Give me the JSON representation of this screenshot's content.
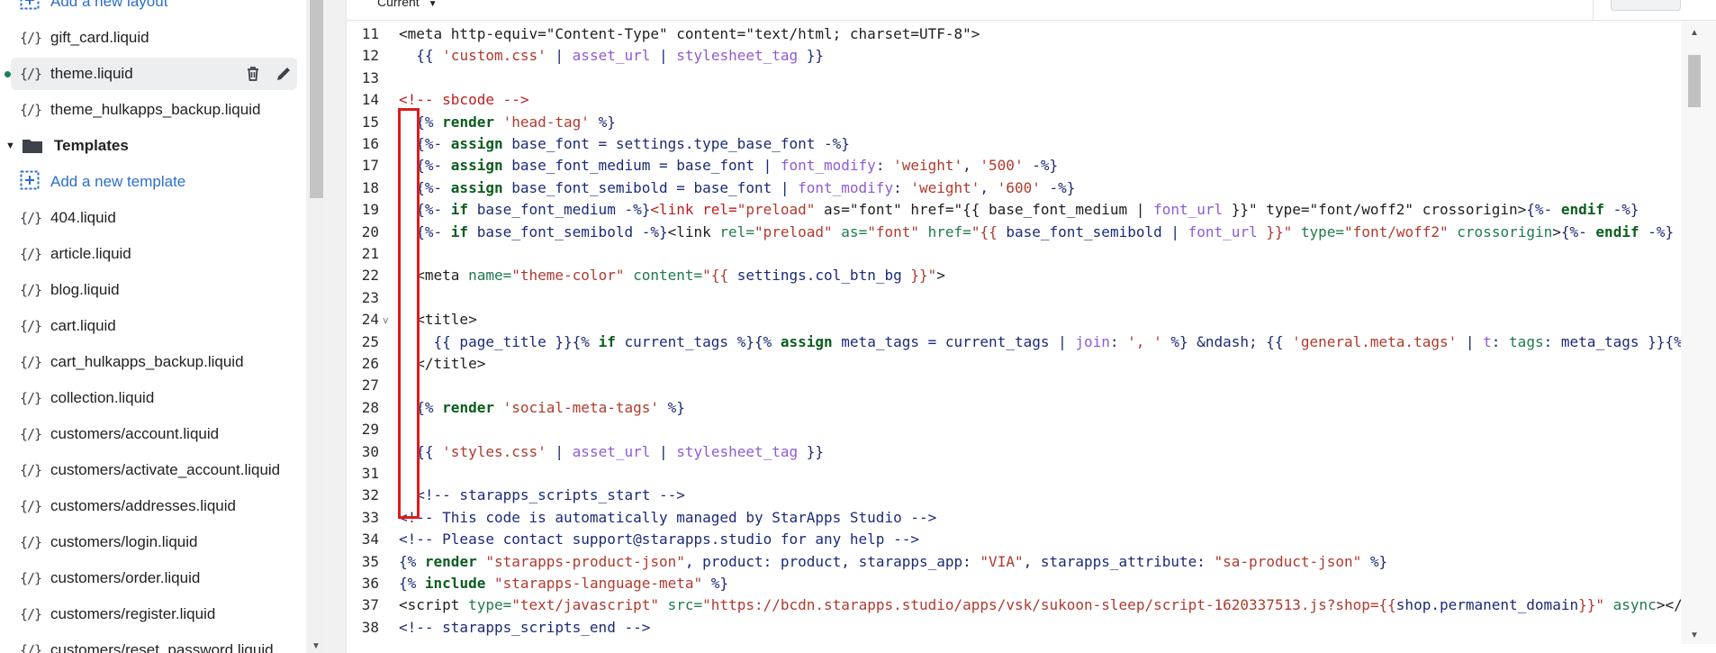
{
  "sidebar": {
    "items": [
      {
        "type": "link",
        "icon": "add-layout-icon",
        "label": "Add a new layout"
      },
      {
        "type": "file",
        "label": "gift_card.liquid"
      },
      {
        "type": "file",
        "label": "theme.liquid",
        "selected": true
      },
      {
        "type": "file",
        "label": "theme_hulkapps_backup.liquid"
      },
      {
        "type": "folder",
        "label": "Templates"
      },
      {
        "type": "link",
        "icon": "add-template-icon",
        "label": "Add a new template"
      },
      {
        "type": "file",
        "label": "404.liquid"
      },
      {
        "type": "file",
        "label": "article.liquid"
      },
      {
        "type": "file",
        "label": "blog.liquid"
      },
      {
        "type": "file",
        "label": "cart.liquid"
      },
      {
        "type": "file",
        "label": "cart_hulkapps_backup.liquid"
      },
      {
        "type": "file",
        "label": "collection.liquid"
      },
      {
        "type": "file",
        "label": "customers/account.liquid"
      },
      {
        "type": "file",
        "label": "customers/activate_account.liquid"
      },
      {
        "type": "file",
        "label": "customers/addresses.liquid"
      },
      {
        "type": "file",
        "label": "customers/login.liquid"
      },
      {
        "type": "file",
        "label": "customers/order.liquid"
      },
      {
        "type": "file",
        "label": "customers/register.liquid"
      },
      {
        "type": "file",
        "label": "customers/reset_password.liquid"
      }
    ],
    "file_icon_text": "{/}"
  },
  "editor": {
    "version_label": "Current",
    "lines": [
      {
        "n": "11",
        "t": [
          [
            "t",
            "<meta http-equiv=\"Content-Type\" content=\"text/html; charset=UTF-8\">"
          ]
        ]
      },
      {
        "n": "12",
        "t": [
          [
            "d",
            "  {{ "
          ],
          [
            "s",
            "'custom.css'"
          ],
          [
            "d",
            " | "
          ],
          [
            "f",
            "asset_url"
          ],
          [
            "d",
            " | "
          ],
          [
            "f",
            "stylesheet_tag"
          ],
          [
            "d",
            " }}"
          ]
        ]
      },
      {
        "n": "13",
        "t": []
      },
      {
        "n": "14",
        "t": [
          [
            "c",
            "<!-- sbcode -->"
          ]
        ]
      },
      {
        "n": "15",
        "t": [
          [
            "d",
            "  {% "
          ],
          [
            "k",
            "render"
          ],
          [
            "d",
            " "
          ],
          [
            "s",
            "'head-tag'"
          ],
          [
            "d",
            " %}"
          ]
        ]
      },
      {
        "n": "16",
        "t": [
          [
            "d",
            "  {%- "
          ],
          [
            "k",
            "assign"
          ],
          [
            "d",
            " base_font = settings.type_base_font -%}"
          ]
        ]
      },
      {
        "n": "17",
        "t": [
          [
            "d",
            "  {%- "
          ],
          [
            "k",
            "assign"
          ],
          [
            "d",
            " base_font_medium = base_font | "
          ],
          [
            "f",
            "font_modify"
          ],
          [
            "d",
            ": "
          ],
          [
            "s",
            "'weight'"
          ],
          [
            "d",
            ", "
          ],
          [
            "s",
            "'500'"
          ],
          [
            "d",
            " -%}"
          ]
        ]
      },
      {
        "n": "18",
        "t": [
          [
            "d",
            "  {%- "
          ],
          [
            "k",
            "assign"
          ],
          [
            "d",
            " base_font_semibold = base_font | "
          ],
          [
            "f",
            "font_modify"
          ],
          [
            "d",
            ": "
          ],
          [
            "s",
            "'weight'"
          ],
          [
            "d",
            ", "
          ],
          [
            "s",
            "'600'"
          ],
          [
            "d",
            " -%}"
          ]
        ]
      },
      {
        "n": "19",
        "t": [
          [
            "d",
            "  {%- "
          ],
          [
            "k",
            "if"
          ],
          [
            "d",
            " base_font_medium -%}"
          ],
          [
            "c",
            "<link rel="
          ],
          [
            "s",
            "\"preload\""
          ],
          [
            "t",
            " as=\"font\" href=\"{{ base_font_medium | "
          ],
          [
            "f",
            "font_url"
          ],
          [
            "t",
            " }}\" type=\"font/woff2\" crossorigin>"
          ],
          [
            "d",
            "{%- "
          ],
          [
            "k",
            "endif"
          ],
          [
            "d",
            " -%}"
          ]
        ]
      },
      {
        "n": "20",
        "t": [
          [
            "d",
            "  {%- "
          ],
          [
            "k",
            "if"
          ],
          [
            "d",
            " base_font_semibold -%}"
          ],
          [
            "t",
            "<link "
          ],
          [
            "a",
            "rel="
          ],
          [
            "s",
            "\"preload\""
          ],
          [
            "t",
            " "
          ],
          [
            "a",
            "as="
          ],
          [
            "s",
            "\"font\""
          ],
          [
            "t",
            " "
          ],
          [
            "a",
            "href="
          ],
          [
            "s",
            "\"{{ "
          ],
          [
            "d",
            "base_font_semibold | "
          ],
          [
            "f",
            "font_url"
          ],
          [
            "s",
            " }}\""
          ],
          [
            "t",
            " "
          ],
          [
            "a",
            "type="
          ],
          [
            "s",
            "\"font/woff2\""
          ],
          [
            "t",
            " "
          ],
          [
            "a",
            "crossorigin"
          ],
          [
            "t",
            ">"
          ],
          [
            "d",
            "{%- "
          ],
          [
            "k",
            "endif"
          ],
          [
            "d",
            " -%}"
          ]
        ]
      },
      {
        "n": "21",
        "t": []
      },
      {
        "n": "22",
        "t": [
          [
            "t",
            "  <meta "
          ],
          [
            "a",
            "name="
          ],
          [
            "s",
            "\"theme-color\""
          ],
          [
            "t",
            " "
          ],
          [
            "a",
            "content="
          ],
          [
            "s",
            "\"{{ "
          ],
          [
            "d",
            "settings.col_btn_bg"
          ],
          [
            "s",
            " }}\""
          ],
          [
            "t",
            ">"
          ]
        ]
      },
      {
        "n": "23",
        "t": []
      },
      {
        "n": "24",
        "fold": true,
        "t": [
          [
            "t",
            "  <title>"
          ]
        ]
      },
      {
        "n": "25",
        "t": [
          [
            "d",
            "    {{ page_title }}{% "
          ],
          [
            "k",
            "if"
          ],
          [
            "d",
            " current_tags %}{% "
          ],
          [
            "k",
            "assign"
          ],
          [
            "d",
            " meta_tags = current_tags | "
          ],
          [
            "f",
            "join"
          ],
          [
            "d",
            ": "
          ],
          [
            "s",
            "', '"
          ],
          [
            "d",
            " %} &ndash; {{ "
          ],
          [
            "s",
            "'general.meta.tags'"
          ],
          [
            "d",
            " | "
          ],
          [
            "f",
            "t"
          ],
          [
            "d",
            ": "
          ],
          [
            "a",
            "tags"
          ],
          [
            "d",
            ": meta_tags }}{%"
          ]
        ]
      },
      {
        "n": "26",
        "t": [
          [
            "t",
            "  </title>"
          ]
        ]
      },
      {
        "n": "27",
        "t": []
      },
      {
        "n": "28",
        "t": [
          [
            "d",
            "  {% "
          ],
          [
            "k",
            "render"
          ],
          [
            "d",
            " "
          ],
          [
            "s",
            "'social-meta-tags'"
          ],
          [
            "d",
            " %}"
          ]
        ]
      },
      {
        "n": "29",
        "t": []
      },
      {
        "n": "30",
        "t": [
          [
            "d",
            "  {{ "
          ],
          [
            "s",
            "'styles.css'"
          ],
          [
            "d",
            " | "
          ],
          [
            "f",
            "asset_url"
          ],
          [
            "d",
            " | "
          ],
          [
            "f",
            "stylesheet_tag"
          ],
          [
            "d",
            " }}"
          ]
        ]
      },
      {
        "n": "31",
        "t": []
      },
      {
        "n": "32",
        "t": [
          [
            "d",
            "  <!-- starapps_scripts_start -->"
          ]
        ]
      },
      {
        "n": "33",
        "t": [
          [
            "d",
            "<!-- This code is automatically managed by StarApps Studio -->"
          ]
        ]
      },
      {
        "n": "34",
        "t": [
          [
            "d",
            "<!-- Please contact support@starapps.studio for any help -->"
          ]
        ]
      },
      {
        "n": "35",
        "t": [
          [
            "d",
            "{% "
          ],
          [
            "k",
            "render"
          ],
          [
            "d",
            " "
          ],
          [
            "s",
            "\"starapps-product-json\""
          ],
          [
            "d",
            ", product: product, starapps_app: "
          ],
          [
            "s",
            "\"VIA\""
          ],
          [
            "d",
            ", starapps_attribute: "
          ],
          [
            "s",
            "\"sa-product-json\""
          ],
          [
            "d",
            " %}"
          ]
        ]
      },
      {
        "n": "36",
        "t": [
          [
            "d",
            "{% "
          ],
          [
            "k",
            "include"
          ],
          [
            "d",
            " "
          ],
          [
            "s",
            "\"starapps-language-meta\""
          ],
          [
            "d",
            " %}"
          ]
        ]
      },
      {
        "n": "37",
        "t": [
          [
            "t",
            "<script "
          ],
          [
            "a",
            "type="
          ],
          [
            "s",
            "\"text/javascript\""
          ],
          [
            "t",
            " "
          ],
          [
            "a",
            "src="
          ],
          [
            "s",
            "\"https://bcdn.starapps.studio/apps/vsk/sukoon-sleep/script-1620337513.js?shop={{"
          ],
          [
            "d",
            "shop.permanent_domain"
          ],
          [
            "s",
            "}}\""
          ],
          [
            "t",
            " "
          ],
          [
            "a",
            "async"
          ],
          [
            "t",
            "></"
          ]
        ]
      },
      {
        "n": "38",
        "t": [
          [
            "d",
            "<!-- starapps_scripts_end -->"
          ]
        ]
      }
    ]
  }
}
